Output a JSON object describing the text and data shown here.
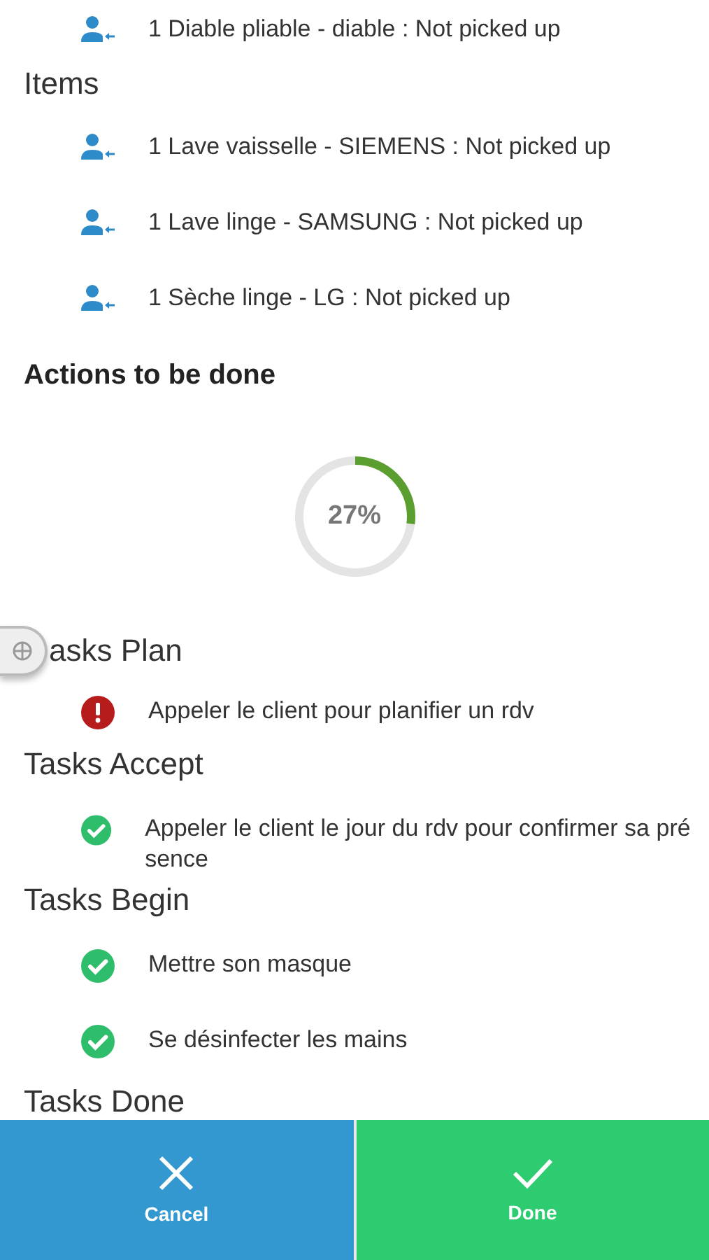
{
  "item_groups": [
    {
      "items": [
        {
          "label": "1 Diable pliable - diable : Not picked up"
        }
      ]
    },
    {
      "title": "Items",
      "items": [
        {
          "label": "1 Lave vaisselle - SIEMENS : Not picked up"
        },
        {
          "label": "1 Lave linge - SAMSUNG : Not picked up"
        },
        {
          "label": "1 Sèche linge - LG : Not picked up"
        }
      ]
    }
  ],
  "actions": {
    "title": "Actions to be done",
    "progress": {
      "level": 0.27,
      "label": "27%"
    }
  },
  "task_groups": [
    {
      "title": "asks Plan",
      "handle": true,
      "tasks": [
        {
          "label": "Appeler le client pour planifier un rdv",
          "kind": "error"
        }
      ]
    },
    {
      "title": "Tasks Accept",
      "tasks": [
        {
          "label": "Appeler le client le jour du rdv pour confirmer sa présence",
          "kind": "done"
        }
      ]
    },
    {
      "title": "Tasks Begin",
      "tasks": [
        {
          "label": "Mettre son masque",
          "kind": "done"
        },
        {
          "label": "Se désinfecter les mains",
          "kind": "done"
        }
      ]
    },
    {
      "title": "Tasks Done"
    }
  ],
  "buttons": [
    {
      "kind": "cancel",
      "label": "Cancel"
    },
    {
      "kind": "done",
      "label": "Done"
    }
  ]
}
